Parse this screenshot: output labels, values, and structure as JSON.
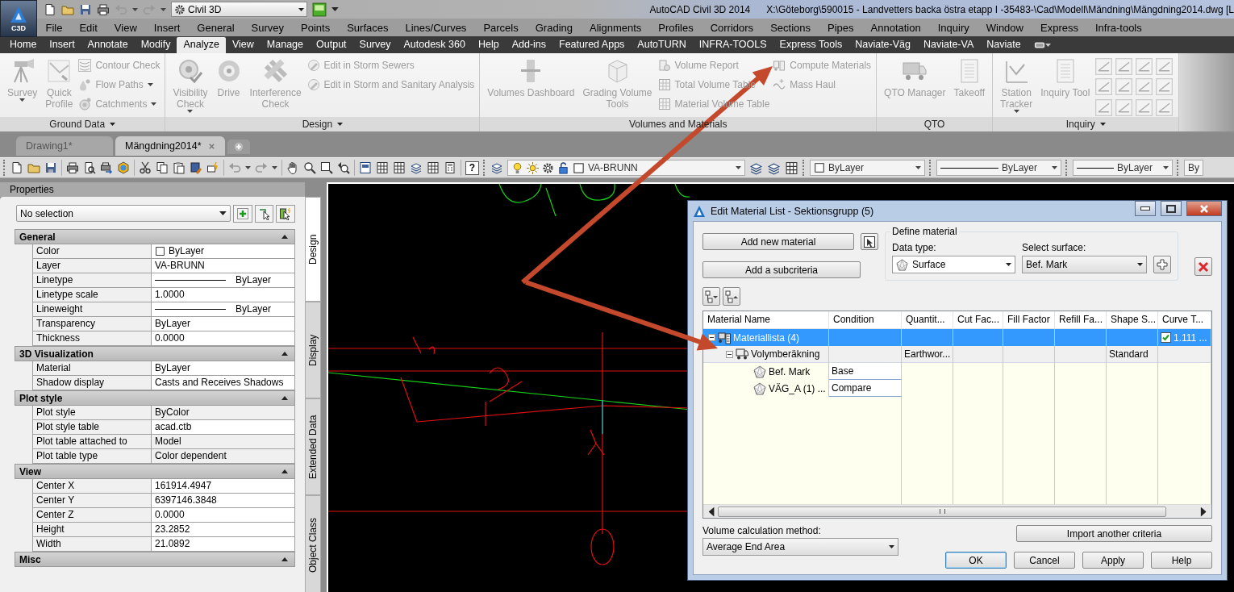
{
  "app_button": {
    "label": "C3D"
  },
  "title_bar": {
    "workspace": "Civil 3D",
    "app_name": "AutoCAD Civil 3D 2014",
    "file_path": "X:\\Göteborg\\590015 - Landvetters backa östra etapp I -35483-\\Cad\\Modell\\Mändning\\Mängdning2014.dwg [L"
  },
  "menu_bar": [
    "File",
    "Edit",
    "View",
    "Insert",
    "General",
    "Survey",
    "Points",
    "Surfaces",
    "Lines/Curves",
    "Parcels",
    "Grading",
    "Alignments",
    "Profiles",
    "Corridors",
    "Sections",
    "Pipes",
    "Annotation",
    "Inquiry",
    "Window",
    "Express",
    "Infra-tools"
  ],
  "ribbon_tabs": [
    {
      "label": "Home",
      "selected": false
    },
    {
      "label": "Insert",
      "selected": false
    },
    {
      "label": "Annotate",
      "selected": false
    },
    {
      "label": "Modify",
      "selected": false
    },
    {
      "label": "Analyze",
      "selected": true
    },
    {
      "label": "View",
      "selected": false
    },
    {
      "label": "Manage",
      "selected": false
    },
    {
      "label": "Output",
      "selected": false
    },
    {
      "label": "Survey",
      "selected": false
    },
    {
      "label": "Autodesk 360",
      "selected": false
    },
    {
      "label": "Help",
      "selected": false
    },
    {
      "label": "Add-ins",
      "selected": false
    },
    {
      "label": "Featured Apps",
      "selected": false
    },
    {
      "label": "AutoTURN",
      "selected": false
    },
    {
      "label": "INFRA-TOOLS",
      "selected": false
    },
    {
      "label": "Express Tools",
      "selected": false
    },
    {
      "label": "Naviate-Väg",
      "selected": false
    },
    {
      "label": "Naviate-VA",
      "selected": false
    },
    {
      "label": "Naviate",
      "selected": false
    }
  ],
  "ribbon_panels": [
    {
      "title": "Ground Data",
      "dropdown": true,
      "items": [
        {
          "kind": "large",
          "label": "Survey",
          "dropdown": true,
          "disabled": true
        },
        {
          "kind": "large",
          "label": "Quick\nProfile",
          "dropdown": false,
          "disabled": true
        },
        {
          "kind": "small",
          "label": "Contour Check",
          "dropdown": false,
          "disabled": true
        },
        {
          "kind": "small",
          "label": "Flow Paths",
          "dropdown": true,
          "disabled": true
        },
        {
          "kind": "small",
          "label": "Catchments",
          "dropdown": true,
          "disabled": true
        }
      ]
    },
    {
      "title": "Design",
      "dropdown": true,
      "items": [
        {
          "kind": "large",
          "label": "Visibility\nCheck",
          "dropdown": true,
          "disabled": true
        },
        {
          "kind": "large",
          "label": "Drive",
          "dropdown": false,
          "disabled": true
        },
        {
          "kind": "large",
          "label": "Interference\nCheck",
          "dropdown": false,
          "disabled": true
        },
        {
          "kind": "small",
          "label": "Edit in Storm Sewers",
          "dropdown": false,
          "disabled": true
        },
        {
          "kind": "small",
          "label": "Edit in Storm and Sanitary Analysis",
          "dropdown": false,
          "disabled": true
        }
      ]
    },
    {
      "title": "Volumes and Materials",
      "dropdown": false,
      "items": [
        {
          "kind": "large",
          "label": "Volumes Dashboard",
          "dropdown": false,
          "disabled": true
        },
        {
          "kind": "large",
          "label": "Grading Volume\nTools",
          "dropdown": false,
          "disabled": true
        },
        {
          "kind": "small",
          "label": "Volume Report",
          "dropdown": false,
          "disabled": true
        },
        {
          "kind": "small",
          "label": "Total Volume Table",
          "dropdown": false,
          "disabled": true
        },
        {
          "kind": "small",
          "label": "Material Volume Table",
          "dropdown": false,
          "disabled": true
        },
        {
          "kind": "small",
          "label": "Compute Materials",
          "dropdown": false,
          "disabled": true
        },
        {
          "kind": "small",
          "label": "Mass Haul",
          "dropdown": false,
          "disabled": true
        }
      ]
    },
    {
      "title": "QTO",
      "dropdown": false,
      "items": [
        {
          "kind": "large",
          "label": "QTO Manager",
          "dropdown": false,
          "disabled": true
        },
        {
          "kind": "large",
          "label": "Takeoff",
          "dropdown": false,
          "disabled": true
        }
      ]
    },
    {
      "title": "Inquiry",
      "dropdown": true,
      "tool_grid": true,
      "items": [
        {
          "kind": "large",
          "label": "Station\nTracker",
          "dropdown": true,
          "disabled": true
        },
        {
          "kind": "large",
          "label": "Inquiry Tool",
          "dropdown": false,
          "disabled": true
        }
      ]
    }
  ],
  "file_tabs": [
    {
      "label": "Drawing1*",
      "selected": false
    },
    {
      "label": "Mängdning2014*",
      "selected": true
    }
  ],
  "toolbar": {
    "help_label": "?",
    "layer": "VA-BRUNN",
    "color_value": "ByLayer",
    "linetype": "ByLayer",
    "lineweight": "ByLayer",
    "plot_style": "By"
  },
  "properties": {
    "title": "Properties",
    "selection": "No selection",
    "sections": [
      {
        "title": "General",
        "rows": [
          {
            "label": "Color",
            "value": "ByLayer",
            "kind": "color",
            "readonly": false
          },
          {
            "label": "Layer",
            "value": "VA-BRUNN",
            "kind": "text",
            "readonly": false
          },
          {
            "label": "Linetype",
            "value": "ByLayer",
            "kind": "line",
            "readonly": false
          },
          {
            "label": "Linetype scale",
            "value": "1.0000",
            "kind": "text",
            "readonly": false
          },
          {
            "label": "Lineweight",
            "value": "ByLayer",
            "kind": "line",
            "readonly": false
          },
          {
            "label": "Transparency",
            "value": "ByLayer",
            "kind": "text",
            "readonly": false
          },
          {
            "label": "Thickness",
            "value": "0.0000",
            "kind": "text",
            "readonly": false
          }
        ]
      },
      {
        "title": "3D Visualization",
        "rows": [
          {
            "label": "Material",
            "value": "ByLayer",
            "kind": "text",
            "readonly": false
          },
          {
            "label": "Shadow display",
            "value": "Casts and Receives Shadows",
            "kind": "text",
            "readonly": false
          }
        ]
      },
      {
        "title": "Plot style",
        "rows": [
          {
            "label": "Plot style",
            "value": "ByColor",
            "kind": "text",
            "readonly": true
          },
          {
            "label": "Plot style table",
            "value": "acad.ctb",
            "kind": "text",
            "readonly": false
          },
          {
            "label": "Plot table attached to",
            "value": "Model",
            "kind": "text",
            "readonly": true
          },
          {
            "label": "Plot table type",
            "value": "Color dependent",
            "kind": "text",
            "readonly": true
          }
        ]
      },
      {
        "title": "View",
        "rows": [
          {
            "label": "Center X",
            "value": "161914.4947",
            "kind": "text",
            "readonly": false
          },
          {
            "label": "Center Y",
            "value": "6397146.3848",
            "kind": "text",
            "readonly": false
          },
          {
            "label": "Center Z",
            "value": "0.0000",
            "kind": "text",
            "readonly": false
          },
          {
            "label": "Height",
            "value": "23.2852",
            "kind": "text",
            "readonly": false
          },
          {
            "label": "Width",
            "value": "21.0892",
            "kind": "text",
            "readonly": false
          }
        ]
      },
      {
        "title": "Misc"
      }
    ]
  },
  "side_tabs": [
    {
      "label": "Design",
      "selected": true
    },
    {
      "label": "Display",
      "selected": false
    },
    {
      "label": "Extended Data",
      "selected": false
    },
    {
      "label": "Object Class",
      "selected": false
    }
  ],
  "dialog": {
    "title": "Edit Material List - Sektionsgrupp (5)",
    "add_material": "Add new material",
    "add_subcriteria": "Add a subcriteria",
    "define_material": {
      "legend": "Define material",
      "data_type_label": "Data type:",
      "data_type": "Surface",
      "surface_label": "Select surface:",
      "surface": "Bef. Mark"
    },
    "columns": [
      "Material Name",
      "Condition",
      "Quantit...",
      "Cut Fac...",
      "Fill Factor",
      "Refill Fa...",
      "Shape S...",
      "Curve T..."
    ],
    "rows": [
      {
        "name": "Materiallista (4)",
        "selected": true,
        "expanded": true,
        "curve_checked": true,
        "curve_value": "1.111 ...",
        "children": [
          {
            "name": "Volymberäkning",
            "selected": false,
            "expanded": true,
            "quantity": "Earthwor...",
            "shape": "Standard",
            "children": [
              {
                "name": "Bef. Mark",
                "selected": false,
                "condition": "Base"
              },
              {
                "name": "VÄG_A (1) ...",
                "selected": false,
                "condition": "Compare"
              }
            ]
          }
        ]
      }
    ],
    "volume_method_label": "Volume calculation method:",
    "volume_method": "Average End Area",
    "import_button": "Import another criteria",
    "buttons": [
      {
        "label": "OK",
        "default": true
      },
      {
        "label": "Cancel",
        "default": false
      },
      {
        "label": "Apply",
        "default": false
      },
      {
        "label": "Help",
        "default": false
      }
    ]
  }
}
